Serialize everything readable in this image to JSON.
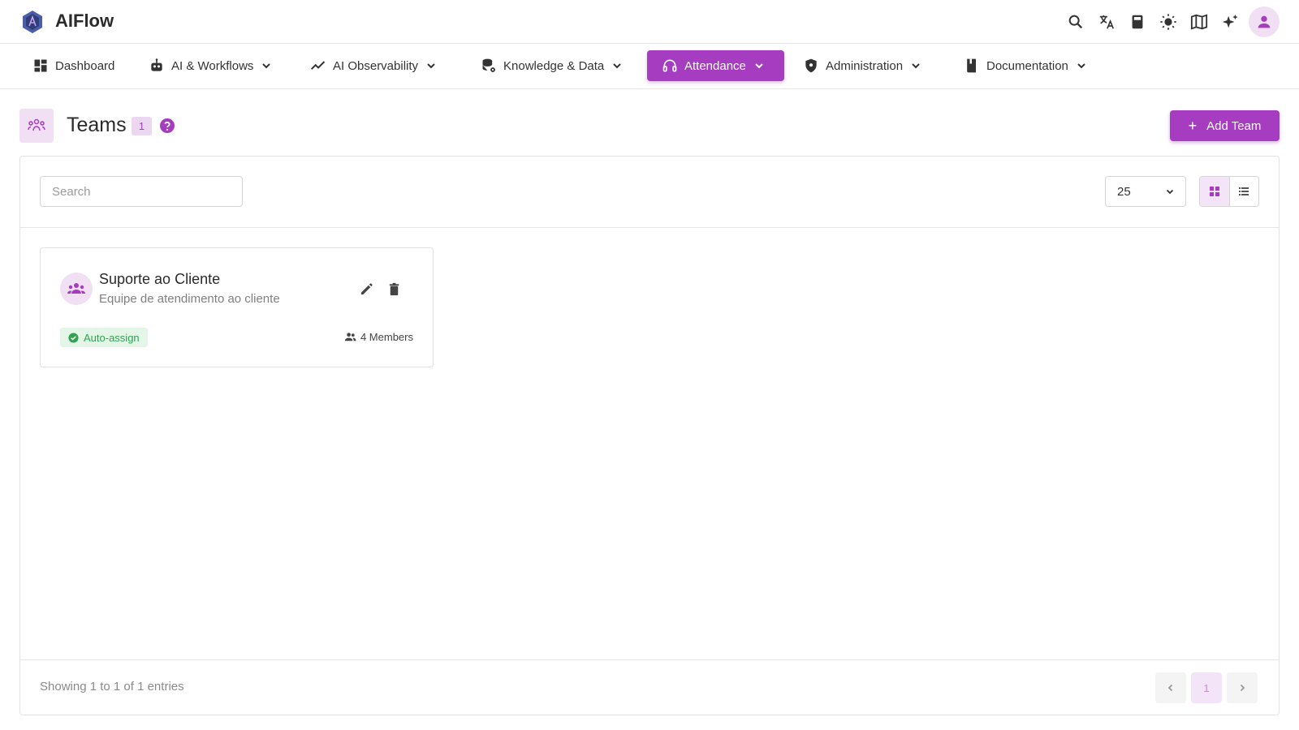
{
  "app": {
    "title": "AIFlow"
  },
  "top_icons": [
    "search-icon",
    "translate-icon",
    "calculator-icon",
    "sun-icon",
    "map-book-icon",
    "sparkles-icon",
    "user-avatar-icon"
  ],
  "nav": {
    "items": [
      {
        "label": "Dashboard",
        "icon": "dashboard-icon",
        "has_dropdown": false
      },
      {
        "label": "AI & Workflows",
        "icon": "robot-icon",
        "has_dropdown": true
      },
      {
        "label": "AI Observability",
        "icon": "trend-line-icon",
        "has_dropdown": true
      },
      {
        "label": "Knowledge & Data",
        "icon": "database-gear-icon",
        "has_dropdown": true
      },
      {
        "label": "Attendance",
        "icon": "headset-icon",
        "has_dropdown": true,
        "active": true
      },
      {
        "label": "Administration",
        "icon": "shield-icon",
        "has_dropdown": true
      },
      {
        "label": "Documentation",
        "icon": "book-icon",
        "has_dropdown": true
      }
    ]
  },
  "header": {
    "title": "Teams",
    "count": "1",
    "add_button_label": "Add Team"
  },
  "toolbar": {
    "search_placeholder": "Search",
    "search_value": "",
    "per_page": "25",
    "view_mode": "grid"
  },
  "teams": [
    {
      "name": "Suporte ao Cliente",
      "description": "Equipe de atendimento ao cliente",
      "badge": "Auto-assign",
      "members": "4 Members"
    }
  ],
  "footer": {
    "entries_text": "Showing 1 to 1 of 1 entries",
    "current_page": "1"
  },
  "colors": {
    "accent": "#a63cc0",
    "accent_light": "#f1dff3",
    "success": "#2ea44f",
    "success_bg": "#e3f6e8"
  }
}
